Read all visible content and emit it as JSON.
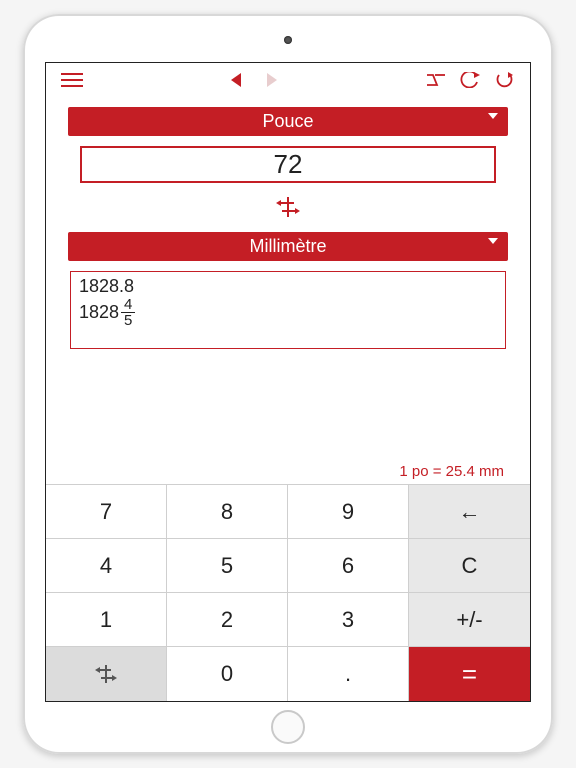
{
  "toolbar": {
    "menu": "menu",
    "prev": "previous",
    "next": "next",
    "backspace_ext": "delete-forward",
    "undo": "undo",
    "redo": "redo"
  },
  "from": {
    "unit_label": "Pouce",
    "value": "72"
  },
  "swap": {
    "label": "swap"
  },
  "to": {
    "unit_label": "Millimètre",
    "decimal": "1828.8",
    "fraction": {
      "whole": "1828",
      "num": "4",
      "den": "5"
    }
  },
  "hint": "1 po = 25.4 mm",
  "keypad": {
    "k7": "7",
    "k8": "8",
    "k9": "9",
    "back": "←",
    "k4": "4",
    "k5": "5",
    "k6": "6",
    "clear": "C",
    "k1": "1",
    "k2": "2",
    "k3": "3",
    "sign": "+/-",
    "swap": "swap",
    "k0": "0",
    "dot": ".",
    "eq": "="
  }
}
